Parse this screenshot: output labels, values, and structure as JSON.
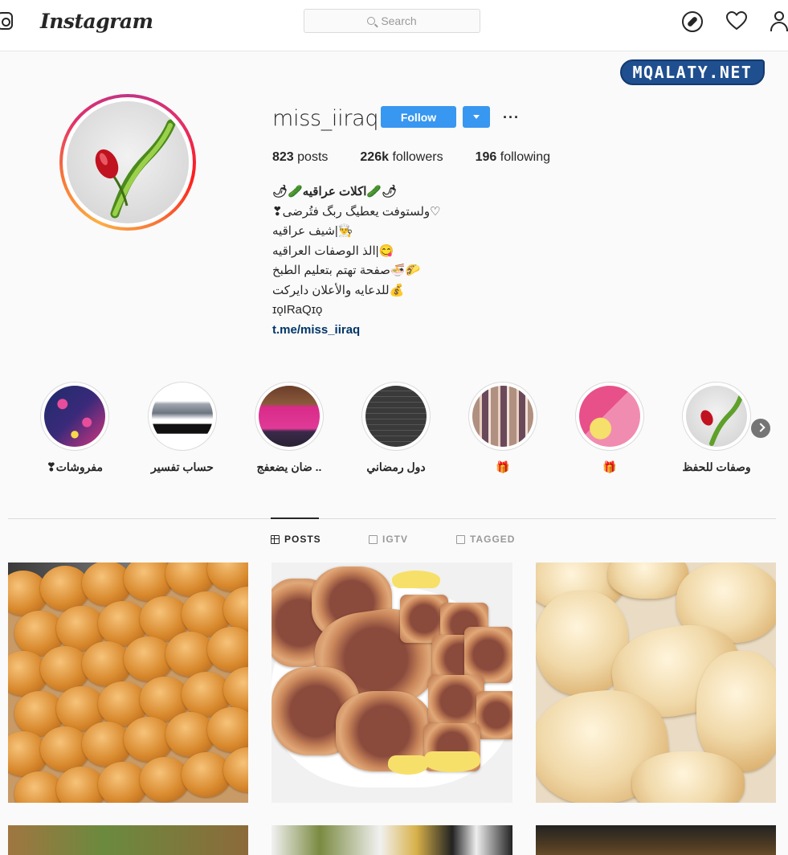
{
  "nav": {
    "brand": "Instagram",
    "search_placeholder": "Search"
  },
  "watermark": "MQALATY.NET",
  "profile": {
    "username": "miss_iiraq",
    "follow_label": "Follow",
    "more_label": "···",
    "stats": {
      "posts_count": "823",
      "posts_label": "posts",
      "followers_count": "226k",
      "followers_label": "followers",
      "following_count": "196",
      "following_label": "following"
    },
    "bio_lines": [
      "🌶🥒اكلات عراقيه🥒🌶",
      "♡ولستوفت يعطيگ ربگ فتُرضى❣",
      "👨‍🍳|شيف عراقيه",
      "😋|الذ الوصفات العراقيه",
      "🌮🍜صفحة تهتم بتعليم الطبخ",
      "💰للدعايه والأعلان دايركت",
      "ɪǫIRaQɪǫ"
    ],
    "bio_link": "t.me/miss_iiraq"
  },
  "highlights": [
    {
      "label": "❣مفروشات"
    },
    {
      "label": "حساب تفسير"
    },
    {
      "label": "ضان يضعفج .."
    },
    {
      "label": "دول رمضاني"
    },
    {
      "label": "🎁"
    },
    {
      "label": "🎁"
    },
    {
      "label": "وصفات للحفظ"
    }
  ],
  "tabs": [
    {
      "label": "POSTS",
      "icon": "grid-icon",
      "active": true
    },
    {
      "label": "IGTV",
      "icon": "igtv-icon",
      "active": false
    },
    {
      "label": "TAGGED",
      "icon": "tagged-icon",
      "active": false
    }
  ],
  "colors": {
    "accent": "#3897f0",
    "watermark_bg": "#1f4f8f",
    "link": "#003569"
  }
}
